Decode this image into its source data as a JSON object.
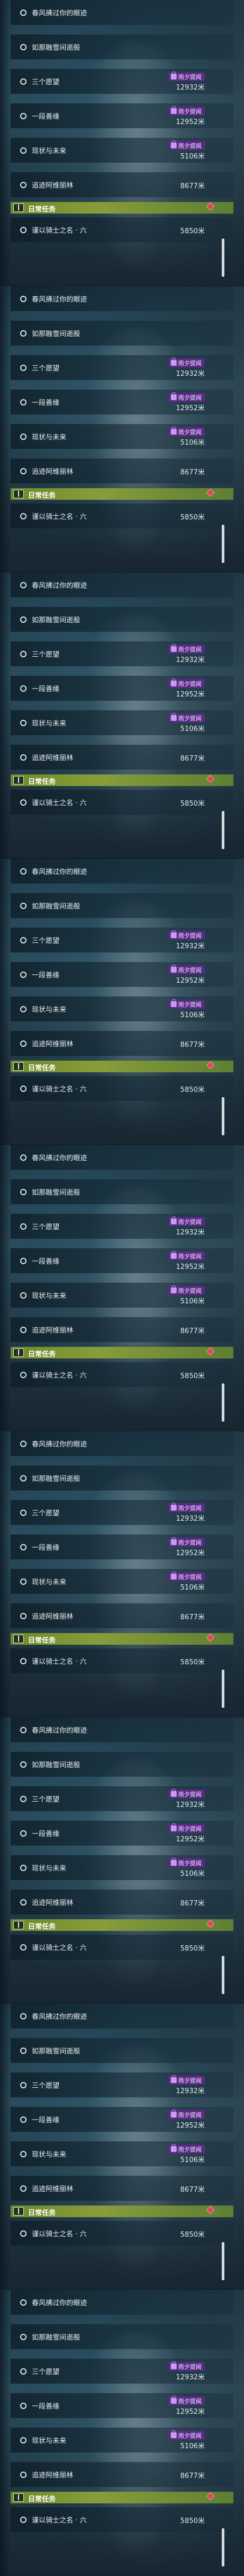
{
  "quest_panel": {
    "quests": [
      {
        "name": "春风拂过你的眼迹",
        "badge": "",
        "distance": ""
      },
      {
        "name": "如那融雪间逝般",
        "badge": "",
        "distance": ""
      },
      {
        "name": "三个愿望",
        "badge": "雨夕提闻",
        "distance": "12932米"
      },
      {
        "name": "一段善缘",
        "badge": "雨夕提闻",
        "distance": "12952米"
      },
      {
        "name": "现状与未来",
        "badge": "雨夕提闻",
        "distance": "5106米"
      },
      {
        "name": "追迹阿维丽林",
        "badge": "",
        "distance": "8677米"
      }
    ],
    "daily_header": "日常任务",
    "daily_quest": {
      "name": "谨以骑士之名 · 六",
      "distance": "5850米"
    },
    "colors": {
      "badge_purple": "#5a2a86",
      "daily_green": "#7a962f",
      "marker_red": "#d84a55"
    },
    "icons": {
      "quest_bullet": "circle-outline-icon",
      "badge": "lock-icon",
      "daily": "book-icon",
      "marker": "red-diamond-icon"
    }
  }
}
